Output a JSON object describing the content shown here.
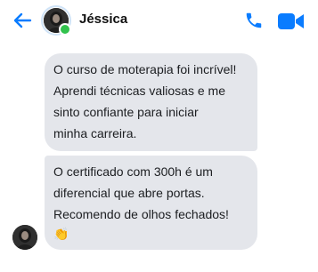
{
  "header": {
    "contact_name": "Jéssica",
    "online": true,
    "accent_color": "#0a7cff",
    "status_color": "#31c24d",
    "icons": {
      "back": "arrow-left-icon",
      "call": "phone-icon",
      "video": "video-camera-icon"
    }
  },
  "messages": [
    {
      "lines": [
        "O curso de moterapia foi incrível!",
        "Aprendi técnicas valiosas e me",
        "sinto confiante para iniciar",
        "minha carreira."
      ]
    },
    {
      "lines": [
        "O certificado com 300h é um",
        "diferencial que abre portas.",
        "Recomendo de olhos fechados!"
      ],
      "emoji": "👏"
    }
  ]
}
